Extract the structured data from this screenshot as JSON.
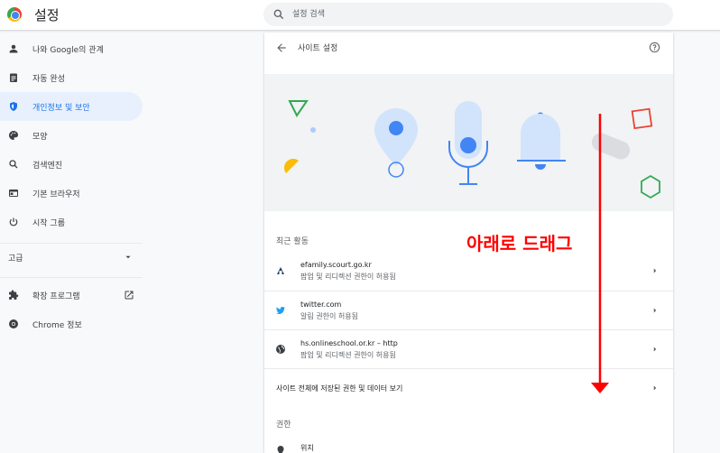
{
  "app": {
    "title": "설정"
  },
  "search": {
    "placeholder": "설정 검색"
  },
  "sidebar": {
    "items": [
      {
        "label": "나와 Google의 관계",
        "icon": "person-icon"
      },
      {
        "label": "자동 완성",
        "icon": "clipboard-icon"
      },
      {
        "label": "개인정보 및 보안",
        "icon": "shield-icon",
        "active": true
      },
      {
        "label": "모양",
        "icon": "palette-icon"
      },
      {
        "label": "검색엔진",
        "icon": "search-icon"
      },
      {
        "label": "기본 브라우저",
        "icon": "browser-icon"
      },
      {
        "label": "시작 그룹",
        "icon": "power-icon"
      }
    ],
    "advanced": {
      "label": "고급",
      "icon": "chevron-down-icon"
    },
    "extensions": {
      "label": "확장 프로그램",
      "icon": "puzzle-icon",
      "trail_icon": "open-in-new-icon"
    },
    "about": {
      "label": "Chrome 정보",
      "icon": "chrome-icon"
    }
  },
  "main": {
    "title": "사이트 설정",
    "recent_activity": {
      "title": "최근 활동",
      "items": [
        {
          "site": "efamily.scourt.go.kr",
          "detail": "팝업 및 리디렉션 권한이 허용됨",
          "icon": "site-favicon-icon"
        },
        {
          "site": "twitter.com",
          "detail": "알림 권한이 허용됨",
          "icon": "twitter-bird-icon"
        },
        {
          "site": "hs.onlineschool.or.kr – http",
          "detail": "팝업 및 리디렉션 권한이 허용됨",
          "icon": "globe-icon"
        }
      ],
      "view_all": "사이트 전체에 저장된 권한 및 데이터 보기"
    },
    "permissions": {
      "title": "권한",
      "first_item": "위치"
    }
  },
  "annotation": {
    "text": "아래로 드래그",
    "color": "#ff0000"
  },
  "colors": {
    "accent": "#1a73e8",
    "active_bg": "#e8f0fe"
  }
}
